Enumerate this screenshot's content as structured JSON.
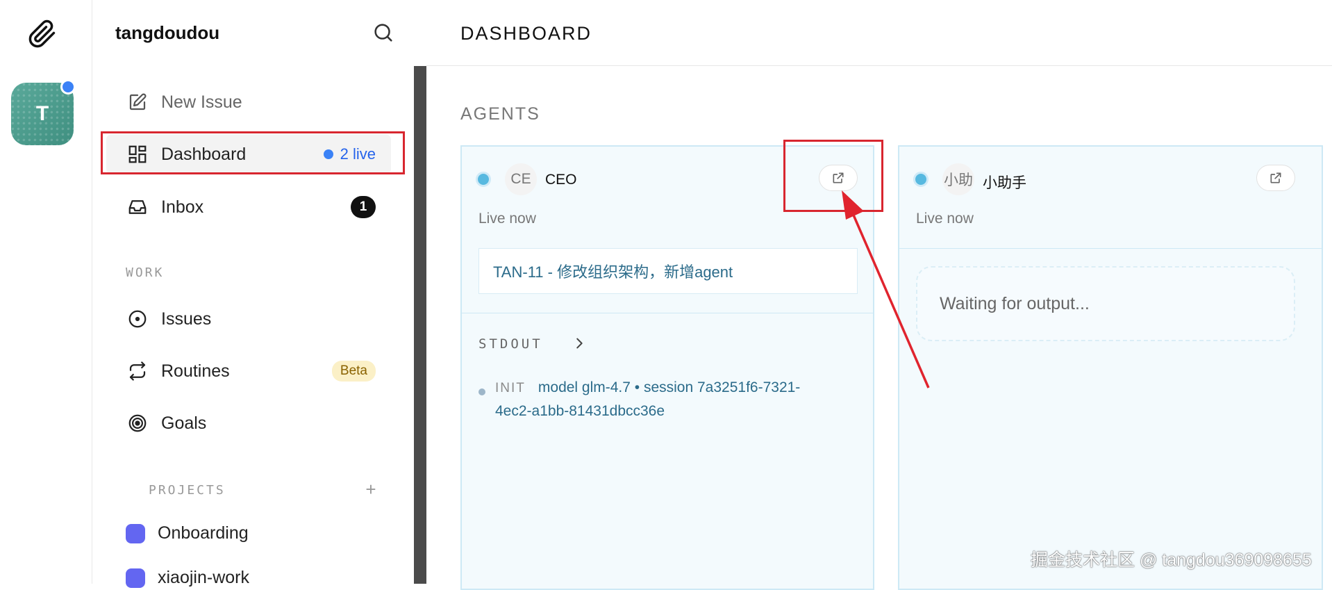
{
  "workspace": {
    "name": "tangdoudou",
    "avatar_letter": "T"
  },
  "nav": {
    "new_issue": "New Issue",
    "dashboard": "Dashboard",
    "dashboard_live": "2 live",
    "inbox": "Inbox",
    "inbox_count": "1"
  },
  "work": {
    "section": "WORK",
    "issues": "Issues",
    "routines": "Routines",
    "routines_badge": "Beta",
    "goals": "Goals"
  },
  "projects": {
    "section": "PROJECTS",
    "items": [
      {
        "name": "Onboarding",
        "color": "#6366f1"
      },
      {
        "name": "xiaojin-work",
        "color": "#6366f1"
      }
    ]
  },
  "page": {
    "title": "DASHBOARD",
    "agents_heading": "AGENTS"
  },
  "agents": [
    {
      "initials": "CE",
      "name": "CEO",
      "status": "Live now",
      "issue": "TAN-11 - 修改组织架构，新增agent",
      "stdout_label": "STDOUT",
      "log_tag": "INIT",
      "log_line1": "model glm-4.7 • session 7a3251f6-7321-",
      "log_line2": "4ec2-a1bb-81431dbcc36e"
    },
    {
      "initials": "小助",
      "name": "小助手",
      "status": "Live now",
      "waiting": "Waiting for output..."
    }
  ],
  "watermark": "掘金技术社区 @ tangdou369098655",
  "colors": {
    "accent": "#3b82f6",
    "highlight": "#d8262f",
    "live_dot": "#57b9e0"
  }
}
